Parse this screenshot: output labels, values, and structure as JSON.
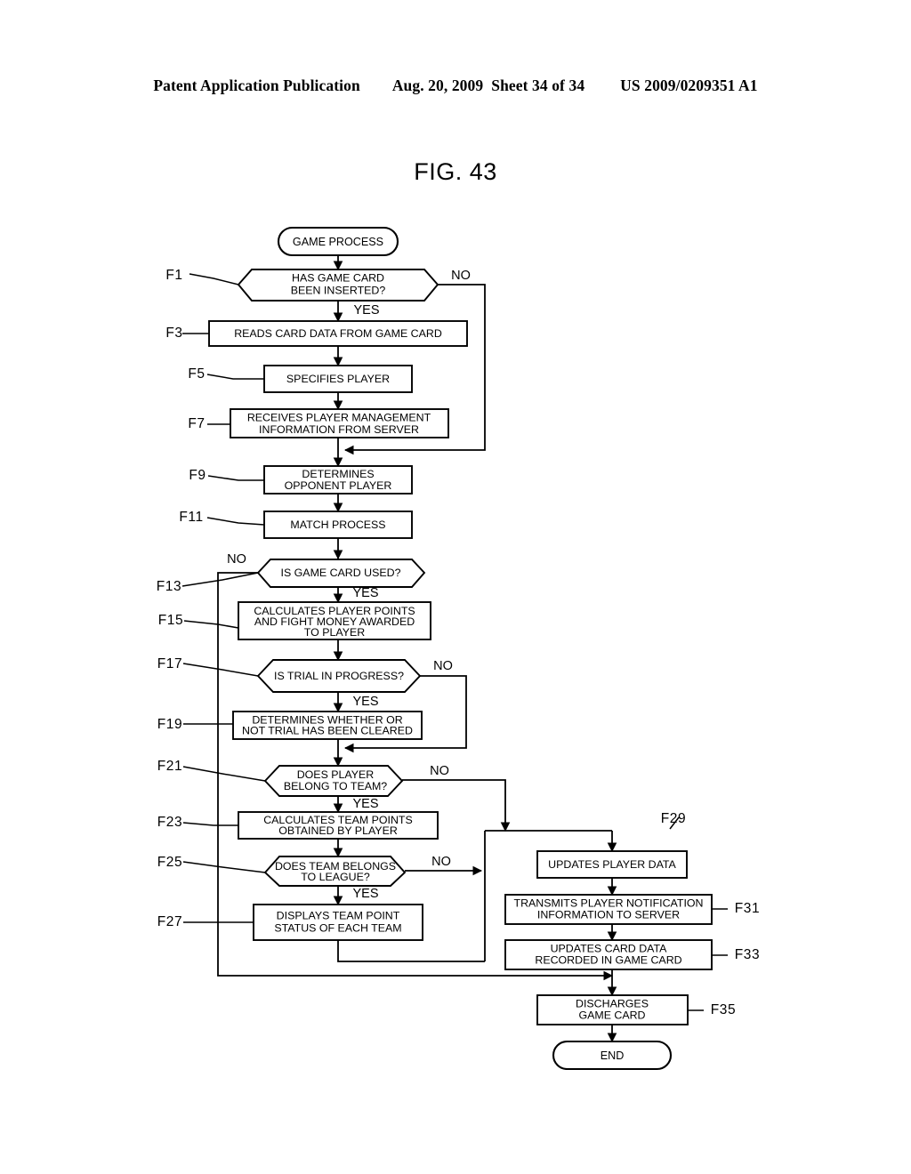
{
  "header": {
    "publication": "Patent Application Publication",
    "date": "Aug. 20, 2009",
    "sheet": "Sheet 34 of 34",
    "patent_number": "US 2009/0209351 A1"
  },
  "figure": {
    "title": "FIG. 43"
  },
  "chart_data": {
    "type": "diagram",
    "diagram_kind": "flowchart",
    "title": "FIG. 43",
    "nodes": [
      {
        "id": "start",
        "step": "",
        "shape": "terminator",
        "text": "GAME PROCESS"
      },
      {
        "id": "f1",
        "step": "F1",
        "shape": "decision",
        "text": "HAS GAME CARD BEEN INSERTED?"
      },
      {
        "id": "f3",
        "step": "F3",
        "shape": "process",
        "text": "READS CARD DATA FROM GAME CARD"
      },
      {
        "id": "f5",
        "step": "F5",
        "shape": "process",
        "text": "SPECIFIES PLAYER"
      },
      {
        "id": "f7",
        "step": "F7",
        "shape": "process",
        "text": "RECEIVES PLAYER MANAGEMENT INFORMATION FROM SERVER"
      },
      {
        "id": "f9",
        "step": "F9",
        "shape": "process",
        "text": "DETERMINES OPPONENT PLAYER"
      },
      {
        "id": "f11",
        "step": "F11",
        "shape": "process",
        "text": "MATCH PROCESS"
      },
      {
        "id": "f13",
        "step": "F13",
        "shape": "decision",
        "text": "IS GAME CARD USED?"
      },
      {
        "id": "f15",
        "step": "F15",
        "shape": "process",
        "text": "CALCULATES PLAYER POINTS AND FIGHT MONEY AWARDED TO PLAYER"
      },
      {
        "id": "f17",
        "step": "F17",
        "shape": "decision",
        "text": "IS TRIAL IN PROGRESS?"
      },
      {
        "id": "f19",
        "step": "F19",
        "shape": "process",
        "text": "DETERMINES WHETHER OR NOT TRIAL HAS BEEN CLEARED"
      },
      {
        "id": "f21",
        "step": "F21",
        "shape": "decision",
        "text": "DOES PLAYER BELONG TO TEAM?"
      },
      {
        "id": "f23",
        "step": "F23",
        "shape": "process",
        "text": "CALCULATES TEAM POINTS OBTAINED BY PLAYER"
      },
      {
        "id": "f25",
        "step": "F25",
        "shape": "decision",
        "text": "DOES TEAM BELONGS TO LEAGUE?"
      },
      {
        "id": "f27",
        "step": "F27",
        "shape": "process",
        "text": "DISPLAYS TEAM POINT STATUS OF EACH TEAM"
      },
      {
        "id": "f29",
        "step": "F29",
        "shape": "process",
        "text": "UPDATES PLAYER DATA"
      },
      {
        "id": "f31",
        "step": "F31",
        "shape": "process",
        "text": "TRANSMITS PLAYER NOTIFICATION INFORMATION TO SERVER"
      },
      {
        "id": "f33",
        "step": "F33",
        "shape": "process",
        "text": "UPDATES CARD DATA RECORDED IN GAME CARD"
      },
      {
        "id": "f35",
        "step": "F35",
        "shape": "process",
        "text": "DISCHARGES GAME CARD"
      },
      {
        "id": "end",
        "step": "",
        "shape": "terminator",
        "text": "END"
      }
    ],
    "edges": [
      {
        "from": "start",
        "to": "f1",
        "label": ""
      },
      {
        "from": "f1",
        "to": "f3",
        "label": "YES"
      },
      {
        "from": "f1",
        "to": "f9",
        "label": "NO"
      },
      {
        "from": "f3",
        "to": "f5",
        "label": ""
      },
      {
        "from": "f5",
        "to": "f7",
        "label": ""
      },
      {
        "from": "f7",
        "to": "f9",
        "label": ""
      },
      {
        "from": "f9",
        "to": "f11",
        "label": ""
      },
      {
        "from": "f11",
        "to": "f13",
        "label": ""
      },
      {
        "from": "f13",
        "to": "f15",
        "label": "YES"
      },
      {
        "from": "f13",
        "to": "f35",
        "label": "NO"
      },
      {
        "from": "f15",
        "to": "f17",
        "label": ""
      },
      {
        "from": "f17",
        "to": "f19",
        "label": "YES"
      },
      {
        "from": "f17",
        "to": "f21",
        "label": "NO"
      },
      {
        "from": "f19",
        "to": "f21",
        "label": ""
      },
      {
        "from": "f21",
        "to": "f23",
        "label": "YES"
      },
      {
        "from": "f21",
        "to": "f29",
        "label": "NO"
      },
      {
        "from": "f23",
        "to": "f25",
        "label": ""
      },
      {
        "from": "f25",
        "to": "f27",
        "label": "YES"
      },
      {
        "from": "f25",
        "to": "f29",
        "label": "NO"
      },
      {
        "from": "f27",
        "to": "f29",
        "label": ""
      },
      {
        "from": "f29",
        "to": "f31",
        "label": ""
      },
      {
        "from": "f31",
        "to": "f33",
        "label": ""
      },
      {
        "from": "f33",
        "to": "f35",
        "label": ""
      },
      {
        "from": "f35",
        "to": "end",
        "label": ""
      }
    ]
  },
  "flow": {
    "start_text": "GAME PROCESS",
    "end_text": "END",
    "f1_line1": "HAS GAME CARD",
    "f1_line2": "BEEN INSERTED?",
    "f3_line1": "READS CARD DATA FROM GAME CARD",
    "f5_line1": "SPECIFIES PLAYER",
    "f7_line1": "RECEIVES PLAYER MANAGEMENT",
    "f7_line2": "INFORMATION FROM SERVER",
    "f9_line1": "DETERMINES",
    "f9_line2": "OPPONENT PLAYER",
    "f11_line1": "MATCH PROCESS",
    "f13_line1": "IS GAME CARD USED?",
    "f15_line1": "CALCULATES PLAYER POINTS",
    "f15_line2": "AND FIGHT MONEY AWARDED",
    "f15_line3": "TO PLAYER",
    "f17_line1": "IS TRIAL IN PROGRESS?",
    "f19_line1": "DETERMINES WHETHER OR",
    "f19_line2": "NOT TRIAL HAS BEEN CLEARED",
    "f21_line1": "DOES PLAYER",
    "f21_line2": "BELONG TO TEAM?",
    "f23_line1": "CALCULATES TEAM POINTS",
    "f23_line2": "OBTAINED BY PLAYER",
    "f25_line1": "DOES TEAM BELONGS",
    "f25_line2": "TO LEAGUE?",
    "f27_line1": "DISPLAYS TEAM POINT",
    "f27_line2": "STATUS OF EACH TEAM",
    "f29_line1": "UPDATES PLAYER DATA",
    "f31_line1": "TRANSMITS PLAYER NOTIFICATION",
    "f31_line2": "INFORMATION TO SERVER",
    "f33_line1": "UPDATES CARD DATA",
    "f33_line2": "RECORDED IN GAME CARD",
    "f35_line1": "DISCHARGES",
    "f35_line2": "GAME CARD"
  },
  "steps": {
    "f1": "F1",
    "f3": "F3",
    "f5": "F5",
    "f7": "F7",
    "f9": "F9",
    "f11": "F11",
    "f13": "F13",
    "f15": "F15",
    "f17": "F17",
    "f19": "F19",
    "f21": "F21",
    "f23": "F23",
    "f25": "F25",
    "f27": "F27",
    "f29": "F29",
    "f31": "F31",
    "f33": "F33",
    "f35": "F35"
  },
  "branches": {
    "yes": "YES",
    "no": "NO"
  }
}
